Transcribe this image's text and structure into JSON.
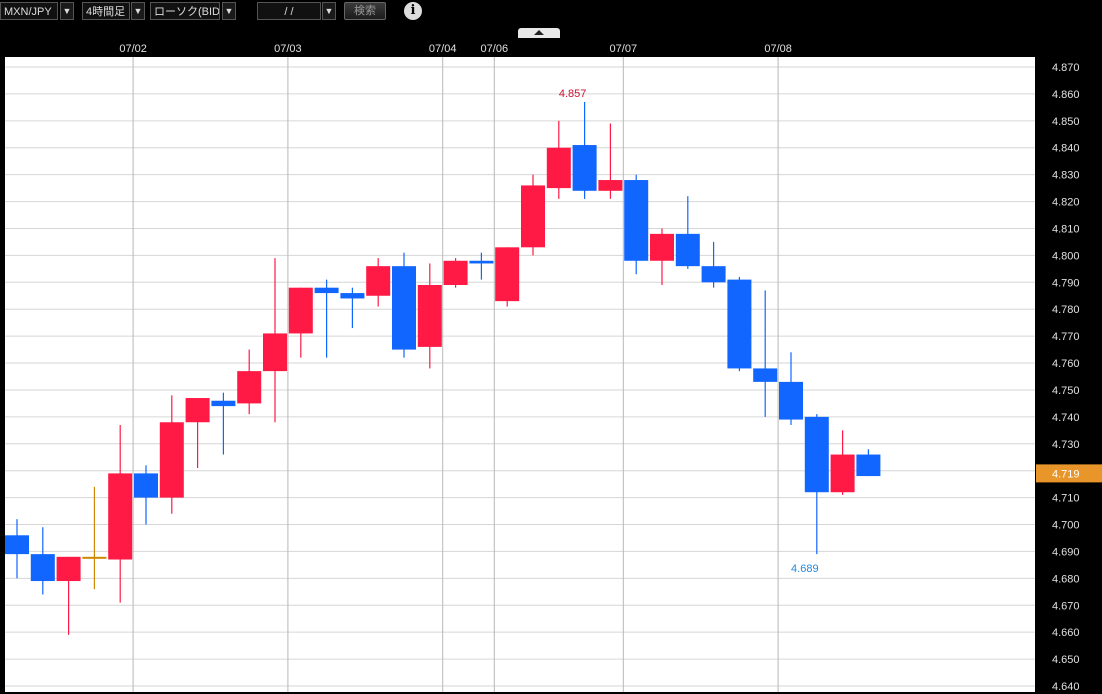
{
  "toolbar": {
    "symbol": "MXN/JPY",
    "period": "4時間足",
    "price_type": "ローソク(BID)",
    "date_input": "/   /",
    "search_label": "検索",
    "info_icon": "info-icon",
    "dropdown_icon": "triangle-down-icon"
  },
  "colors": {
    "up": "#ff1a46",
    "down": "#1166ff",
    "flat": "#cc8800",
    "grid": "#b8b8b8",
    "current_price_bg": "#e8962a",
    "high_label": "#cc1133",
    "low_label": "#2288dd"
  },
  "chart_data": {
    "type": "candlestick",
    "x_tick_labels": [
      {
        "label": "07/02",
        "index": 5
      },
      {
        "label": "07/03",
        "index": 11
      },
      {
        "label": "07/04",
        "index": 17
      },
      {
        "label": "07/06",
        "index": 19
      },
      {
        "label": "07/07",
        "index": 24
      },
      {
        "label": "07/08",
        "index": 30
      }
    ],
    "y_ticks": [
      4.64,
      4.65,
      4.66,
      4.67,
      4.68,
      4.69,
      4.7,
      4.71,
      4.72,
      4.73,
      4.74,
      4.75,
      4.76,
      4.77,
      4.78,
      4.79,
      4.8,
      4.81,
      4.82,
      4.83,
      4.84,
      4.85,
      4.86,
      4.87
    ],
    "ylim": [
      4.64,
      4.871
    ],
    "current_price": "4.719",
    "current_value": 4.719,
    "high_marker": {
      "label": "4.857",
      "index": 22,
      "value": 4.857
    },
    "low_marker": {
      "label": "4.689",
      "index": 31,
      "value": 4.689
    },
    "candles": [
      {
        "o": 4.696,
        "h": 4.702,
        "l": 4.68,
        "c": 4.689
      },
      {
        "o": 4.689,
        "h": 4.699,
        "l": 4.674,
        "c": 4.679
      },
      {
        "o": 4.679,
        "h": 4.688,
        "l": 4.659,
        "c": 4.688
      },
      {
        "o": 4.688,
        "h": 4.714,
        "l": 4.676,
        "c": 4.688
      },
      {
        "o": 4.687,
        "h": 4.737,
        "l": 4.671,
        "c": 4.719
      },
      {
        "o": 4.719,
        "h": 4.722,
        "l": 4.7,
        "c": 4.71
      },
      {
        "o": 4.71,
        "h": 4.748,
        "l": 4.704,
        "c": 4.738
      },
      {
        "o": 4.738,
        "h": 4.747,
        "l": 4.721,
        "c": 4.747
      },
      {
        "o": 4.746,
        "h": 4.749,
        "l": 4.726,
        "c": 4.744
      },
      {
        "o": 4.745,
        "h": 4.765,
        "l": 4.741,
        "c": 4.757
      },
      {
        "o": 4.757,
        "h": 4.799,
        "l": 4.738,
        "c": 4.771
      },
      {
        "o": 4.771,
        "h": 4.788,
        "l": 4.762,
        "c": 4.788
      },
      {
        "o": 4.788,
        "h": 4.791,
        "l": 4.762,
        "c": 4.786
      },
      {
        "o": 4.786,
        "h": 4.788,
        "l": 4.773,
        "c": 4.784
      },
      {
        "o": 4.785,
        "h": 4.799,
        "l": 4.781,
        "c": 4.796
      },
      {
        "o": 4.796,
        "h": 4.801,
        "l": 4.762,
        "c": 4.765
      },
      {
        "o": 4.766,
        "h": 4.797,
        "l": 4.758,
        "c": 4.789
      },
      {
        "o": 4.789,
        "h": 4.799,
        "l": 4.788,
        "c": 4.798
      },
      {
        "o": 4.798,
        "h": 4.801,
        "l": 4.791,
        "c": 4.797
      },
      {
        "o": 4.783,
        "h": 4.803,
        "l": 4.781,
        "c": 4.803
      },
      {
        "o": 4.803,
        "h": 4.83,
        "l": 4.8,
        "c": 4.826
      },
      {
        "o": 4.825,
        "h": 4.85,
        "l": 4.821,
        "c": 4.84
      },
      {
        "o": 4.841,
        "h": 4.857,
        "l": 4.821,
        "c": 4.824
      },
      {
        "o": 4.824,
        "h": 4.849,
        "l": 4.821,
        "c": 4.828
      },
      {
        "o": 4.828,
        "h": 4.83,
        "l": 4.793,
        "c": 4.798
      },
      {
        "o": 4.798,
        "h": 4.81,
        "l": 4.789,
        "c": 4.808
      },
      {
        "o": 4.808,
        "h": 4.822,
        "l": 4.795,
        "c": 4.796
      },
      {
        "o": 4.796,
        "h": 4.805,
        "l": 4.788,
        "c": 4.79
      },
      {
        "o": 4.791,
        "h": 4.792,
        "l": 4.757,
        "c": 4.758
      },
      {
        "o": 4.758,
        "h": 4.787,
        "l": 4.74,
        "c": 4.753
      },
      {
        "o": 4.753,
        "h": 4.764,
        "l": 4.737,
        "c": 4.739
      },
      {
        "o": 4.74,
        "h": 4.741,
        "l": 4.689,
        "c": 4.712
      },
      {
        "o": 4.712,
        "h": 4.735,
        "l": 4.711,
        "c": 4.726
      },
      {
        "o": 4.726,
        "h": 4.728,
        "l": 4.718,
        "c": 4.718
      }
    ]
  }
}
